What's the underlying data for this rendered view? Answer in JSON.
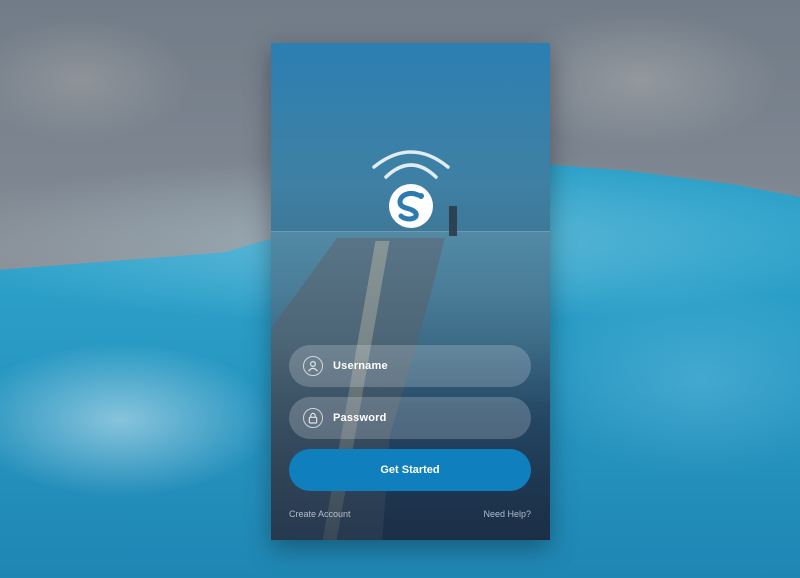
{
  "login": {
    "username_placeholder": "Username",
    "password_placeholder": "Password",
    "submit_label": "Get Started",
    "create_account_label": "Create Account",
    "help_label": "Need Help?"
  },
  "icons": {
    "brand": "app-logo-s",
    "signal": "wifi-signal-arcs",
    "username": "user-icon",
    "password": "lock-icon"
  },
  "colors": {
    "accent": "#0f7fbd",
    "field_bg": "rgba(255,255,255,0.2)"
  }
}
